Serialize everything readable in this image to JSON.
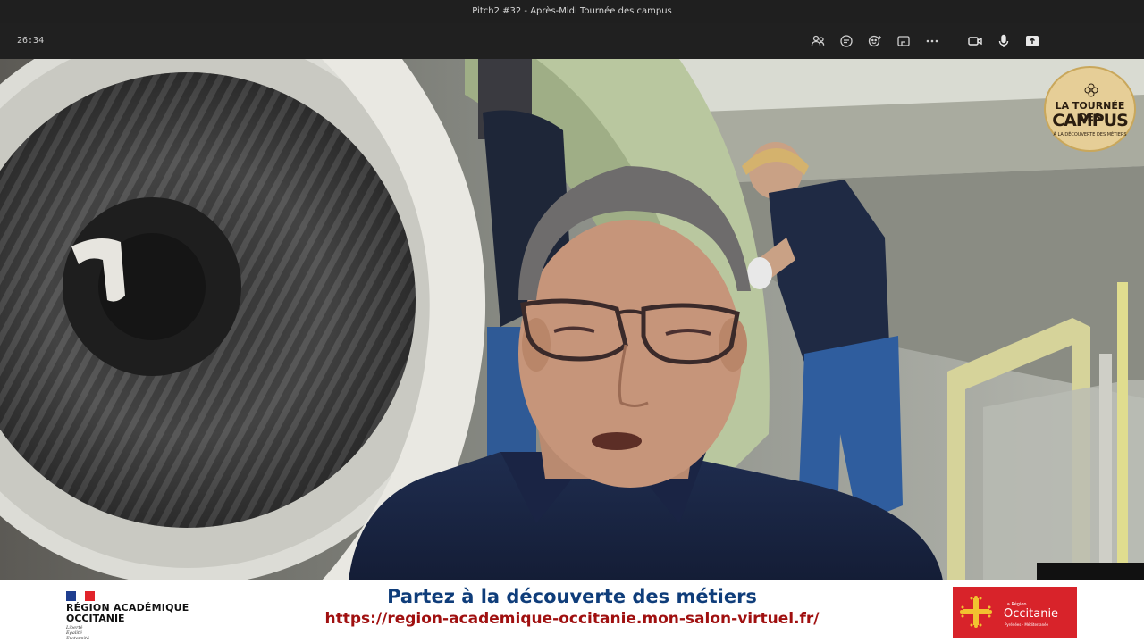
{
  "window": {
    "title": "Pitch2 #32 - Après-Midi Tournée des campus"
  },
  "toolbar": {
    "timer": "26:34",
    "icons": [
      "people-icon",
      "chat-icon",
      "reactions-icon",
      "rooms-icon",
      "more-icon",
      "camera-icon",
      "mic-icon",
      "share-icon"
    ]
  },
  "badge": {
    "line1": "LA TOURNÉE DES",
    "line2": "CAMPUS",
    "line3": "À LA DÉCOUVERTE DES MÉTIERS"
  },
  "banner": {
    "org_line1": "RÉGION ACADÉMIQUE",
    "org_line2": "OCCITANIE",
    "motto1": "Liberté",
    "motto2": "Égalité",
    "motto3": "Fraternité",
    "headline": "Partez à la découverte des métiers",
    "url": "https://region-academique-occitanie.mon-salon-virtuel.fr/",
    "region_small": "La Région",
    "region_name": "Occitanie",
    "region_sub": "Pyrénées - Méditerranée"
  },
  "colors": {
    "headline": "#0f3d7a",
    "url": "#a01010",
    "occitanie_red": "#d8232a",
    "badge": "#e6ce97"
  }
}
